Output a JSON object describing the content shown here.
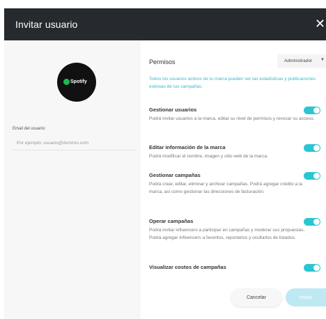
{
  "header": {
    "title": "Invitar usuario",
    "close_glyph": "✕"
  },
  "brand": {
    "name": "Spotify",
    "icon": "spotify-logo-icon",
    "mark_color": "#1db954"
  },
  "email": {
    "label": "Email del usuario:",
    "placeholder": "Por ejemplo: usuario@dominio.com",
    "value": ""
  },
  "permissions": {
    "title": "Permisos",
    "role": {
      "selected": "Administrador",
      "caret": "▼"
    },
    "info": "Todos los usuarios activos de tu marca pueden ver las estadísticas y publicaciones exitosas de tus campañas.",
    "items": [
      {
        "title": "Gestionar usuarios",
        "description": "Podrá invitar usuarios a la marca, editar su nivel de permisos y revocar su acceso.",
        "enabled": true
      },
      {
        "title": "Editar información de la marca",
        "description": "Podrá modificar el nombre, imagen y sitio web de la marca.",
        "enabled": true
      },
      {
        "title": "Gestionar campañas",
        "description": "Podrá crear, editar, eliminar y archivar campañas. Podrá agregar crédito a la marca, así como gestionar las direcciones de facturación.",
        "enabled": true
      },
      {
        "title": "Operar campañas",
        "description": "Podrá invitar influencers a participar en campañas y moderar sus propuestas. Podrá agregar influencers a favoritos, reportarlos y ocultarlos de listados.",
        "enabled": true
      },
      {
        "title": "Visualizar costos de campañas",
        "description": "",
        "enabled": true
      }
    ]
  },
  "actions": {
    "cancel_label": "Cancelar",
    "invite_label": "Invitar"
  },
  "colors": {
    "header_bg": "#262a2e",
    "accent": "#29c6d4",
    "info_text": "#35b8cc",
    "invite_disabled": "#bfe9f2"
  }
}
